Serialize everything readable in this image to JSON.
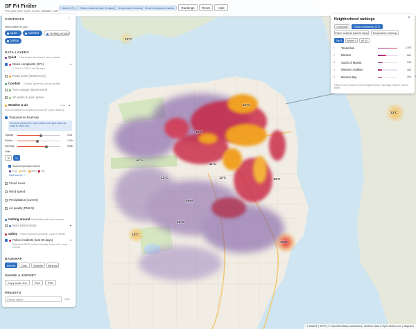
{
  "app": {
    "title": "SF Fit Finder",
    "subtitle": "Find your spot: Quiet, sunny, walkable, safe.",
    "info_icon": "info-icon"
  },
  "topbar": {
    "chips": [
      "Noise (371)",
      "Police incidents (last 90 days)",
      "Temperature heatmap",
      "Show temperature labels"
    ],
    "buttons": [
      "Rankings",
      "Reset",
      "Hide"
    ]
  },
  "controls": {
    "title": "CONTROLS",
    "collapse_icon": "chevron-left-icon",
    "what_matters": "What matters to you?",
    "priorities": [
      {
        "label": "Quiet",
        "active": true
      },
      {
        "label": "Comfort",
        "active": true
      },
      {
        "label": "Getting around",
        "active": false
      },
      {
        "label": "Safety",
        "active": true
      }
    ],
    "data_layers_title": "DATA LAYERS",
    "quiet": {
      "head": "Quiet",
      "desc": "How loud is the street's been a better.",
      "noise_label": "Noise complaints (371)",
      "noise_note": "1,720 of 1,720 • Last 90 days",
      "road_label": "Road noise (DOM proxy)"
    },
    "comfort": {
      "head": "Comfort",
      "desc": "Climate, greenery, and air quality",
      "tree_label": "Tree canopy (street trees)",
      "parks_label": "SF parks & open space"
    },
    "weather": {
      "head": "Weather & air",
      "count": "1 on",
      "desc": "Live atmospheric conditions across SF (Open-Meteo).",
      "heatmap_label": "Temperature heatmap",
      "heatmap_note": "Personal preference: Open-Meteo and pick these as looks to scent this.",
      "sliders": [
        {
          "label": "Opacity",
          "value": "0.55",
          "level": 0.55
        },
        {
          "label": "Radius",
          "value": "1.40×",
          "level": 0.47
        },
        {
          "label": "Intensity",
          "value": "0.68×",
          "level": 0.68
        }
      ],
      "units_label": "Units",
      "units": [
        "°F",
        "°C"
      ],
      "labels_label": "Show temperature labels",
      "legend": [
        "Cool",
        "Mild",
        "Warm",
        "Hot"
      ],
      "legend_link": "Data source ↗",
      "cloud": "Cloud cover",
      "wind": "Wind speed",
      "precip": "Precipitation (current)",
      "air": "Air quality (PM2.5)"
    },
    "getting_around": {
      "head": "Getting around",
      "desc": "Walkability and transit access",
      "muni_label": "Muni transit stops"
    },
    "safety": {
      "head": "Safety",
      "desc": "Police-reported incidents. Lower is better.",
      "police_label": "Police incidents (last 90 days)",
      "police_note": "Reported SFPD incident density. More red = more reports."
    },
    "basemap_title": "BASEMAP",
    "basemaps": [
      "Streets",
      "Dark",
      "Satellite",
      "Minimal"
    ],
    "share_title": "SHARE & EXPORT",
    "share_buttons": [
      "Copy share link",
      "PNG",
      "PDF"
    ],
    "presets_title": "PRESETS",
    "preset_placeholder": "Preset name...",
    "save_label": "Save"
  },
  "rankings": {
    "title": "Neighborhood rankings",
    "close_icon": "close-icon",
    "metric_tabs": [
      "Composite",
      "Noise complaints (371)",
      "Police incidents (last 90 days)",
      "Temperature heatmap"
    ],
    "range_tabs": [
      "Top 5",
      "Bottom 5",
      "All 40"
    ],
    "rows": [
      {
        "rank": "1",
        "name": "Tenderloin",
        "value": "1,309",
        "share": 1.0
      },
      {
        "rank": "2",
        "name": "Mission",
        "value": "562",
        "share": 0.43
      },
      {
        "rank": "3",
        "name": "South of Market",
        "value": "345",
        "share": 0.26
      },
      {
        "rank": "4",
        "name": "Western Addition",
        "value": "283",
        "share": 0.22
      },
      {
        "rank": "5",
        "name": "Mission Bay",
        "value": "306",
        "share": 0.23
      }
    ],
    "footer": "Click a row to zoom to that neighborhood. Rankings respect current filters."
  },
  "temperatures": [
    "12°C",
    "12°C",
    "12°C",
    "11°C",
    "12°C",
    "12°C",
    "12°C",
    "13°C",
    "13°C",
    "13°C",
    "12°C",
    "13°C",
    "13°C"
  ],
  "map_controls": {
    "zoom_in": "+",
    "zoom_out": "−"
  },
  "attribution": "© DataSF | SFPD | © OpenStreetMap contributors | Weather data © Open-Meteo.com | MapLibre",
  "colors": {
    "accent": "#2f6fc1",
    "water": "#cfe6f2",
    "land": "#f1ede4",
    "heat_high": "#c8203f",
    "heat_mid": "#f0a020",
    "heat_low": "#7d5aa6"
  }
}
